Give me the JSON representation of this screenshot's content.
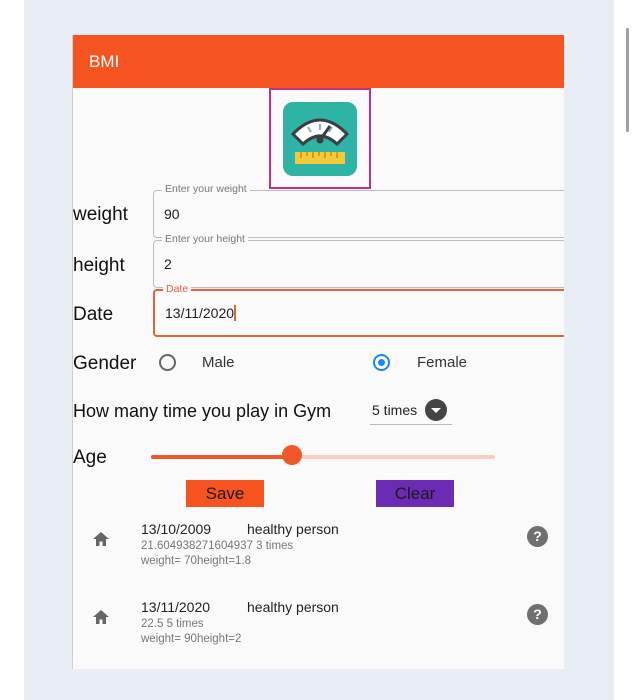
{
  "app": {
    "title": "BMI",
    "logo_icon": "bmi-scale-icon"
  },
  "form": {
    "weight": {
      "label": "weight",
      "legend": "Enter your weight",
      "value": "90"
    },
    "height": {
      "label": "height",
      "legend": "Enter your height",
      "value": "2"
    },
    "date": {
      "label": "Date",
      "legend": "Date",
      "value": "13/11/2020"
    }
  },
  "gender": {
    "label": "Gender",
    "options": [
      "Male",
      "Female"
    ],
    "selected": "Female"
  },
  "gym": {
    "label": "How many time you play in Gym",
    "value": "5 times"
  },
  "age": {
    "label": "Age",
    "value_fraction": 0.41
  },
  "buttons": {
    "save": "Save",
    "clear": "Clear"
  },
  "records": [
    {
      "date": "13/10/2009",
      "status": "healthy person",
      "detail": "21.604938271604937 3 times",
      "measurements": "weight= 70height=1.8"
    },
    {
      "date": "13/11/2020",
      "status": "healthy person",
      "detail": "22.5 5 times",
      "measurements": "weight= 90height=2"
    }
  ],
  "colors": {
    "primary": "#f5531f",
    "accent_purple": "#6c2bb4",
    "radio_blue": "#1e88e5",
    "logo_teal": "#2eb3a4"
  }
}
